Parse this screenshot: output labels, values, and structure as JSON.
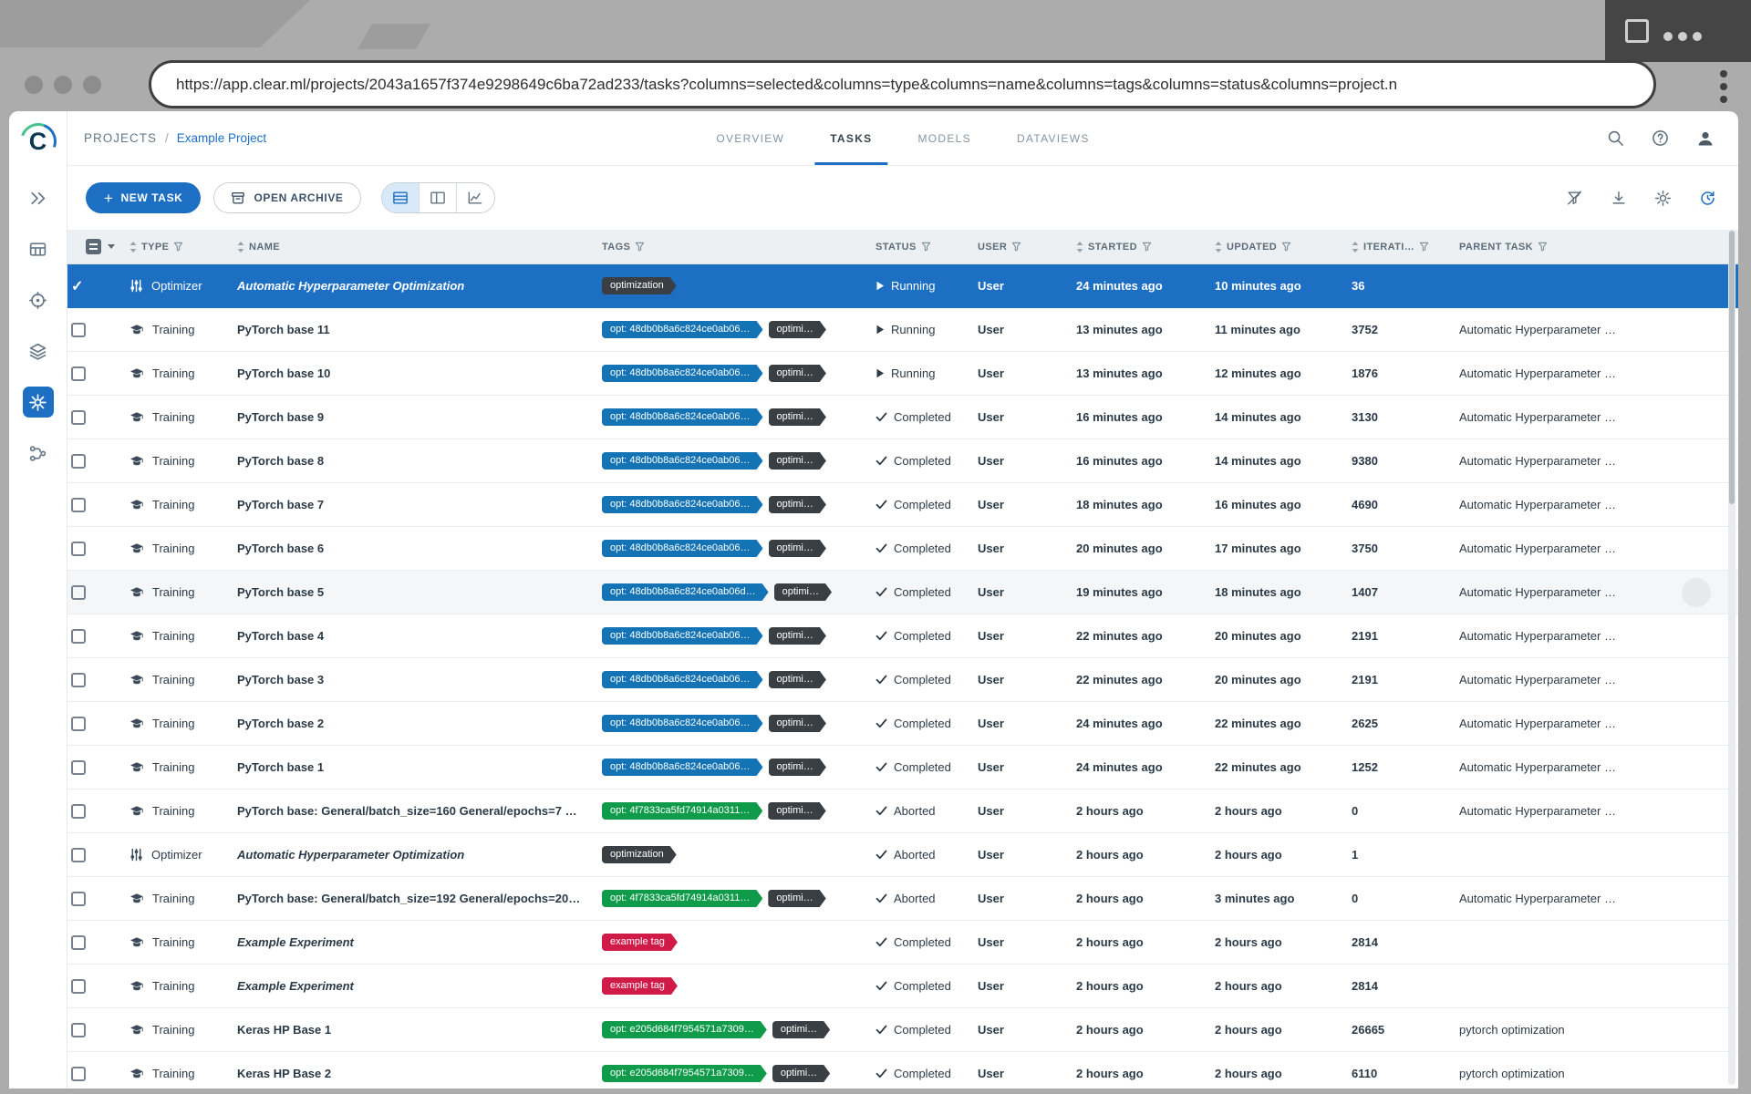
{
  "browser": {
    "url": "https://app.clear.ml/projects/2043a1657f374e9298649c6ba72ad233/tasks?columns=selected&columns=type&columns=name&columns=tags&columns=status&columns=project.n"
  },
  "sidebar": {
    "items": [
      {
        "key": "chevrons",
        "icon": "getting-started-icon",
        "active": false
      },
      {
        "key": "grid",
        "icon": "dashboard-grid-icon",
        "active": false
      },
      {
        "key": "target",
        "icon": "reports-icon",
        "active": false
      },
      {
        "key": "layers",
        "icon": "datasets-icon",
        "active": false
      },
      {
        "key": "node",
        "icon": "projects-icon",
        "active": true
      },
      {
        "key": "pipeline",
        "icon": "pipelines-icon",
        "active": false
      }
    ]
  },
  "header": {
    "breadcrumb": {
      "root": "PROJECTS",
      "separator": "/",
      "current": "Example Project"
    },
    "tabs": [
      {
        "label": "OVERVIEW",
        "active": false
      },
      {
        "label": "TASKS",
        "active": true
      },
      {
        "label": "MODELS",
        "active": false
      },
      {
        "label": "DATAVIEWS",
        "active": false
      }
    ]
  },
  "toolbar": {
    "new_task_plus": "+",
    "new_task": "NEW TASK",
    "open_archive": "OPEN ARCHIVE"
  },
  "table": {
    "columns": [
      {
        "key": "type",
        "label": "TYPE",
        "sort": true,
        "filter": true
      },
      {
        "key": "name",
        "label": "NAME",
        "sort": true,
        "filter": false
      },
      {
        "key": "tags",
        "label": "TAGS",
        "sort": false,
        "filter": true
      },
      {
        "key": "status",
        "label": "STATUS",
        "sort": false,
        "filter": true
      },
      {
        "key": "user",
        "label": "USER",
        "sort": false,
        "filter": true
      },
      {
        "key": "started",
        "label": "STARTED",
        "sort": true,
        "filter": true
      },
      {
        "key": "updated",
        "label": "UPDATED",
        "sort": true,
        "filter": true
      },
      {
        "key": "iterations",
        "label": "ITERATI…",
        "sort": true,
        "filter": true
      },
      {
        "key": "parent",
        "label": "PARENT TASK",
        "sort": false,
        "filter": true
      }
    ],
    "rows": [
      {
        "selected": true,
        "type": "Optimizer",
        "name": "Automatic Hyperparameter Optimization",
        "italic": true,
        "tags": [
          {
            "text": "optimization",
            "color": "dark"
          }
        ],
        "status": "Running",
        "status_kind": "running",
        "user": "User",
        "started": "24 minutes ago",
        "updated": "10 minutes ago",
        "iterations": "36",
        "parent": ""
      },
      {
        "type": "Training",
        "name": "PyTorch base 11",
        "tags": [
          {
            "text": "opt: 48db0b8a6c824ce0ab06…",
            "color": "blue"
          },
          {
            "text": "optimi…",
            "color": "dark"
          }
        ],
        "status": "Running",
        "status_kind": "running",
        "user": "User",
        "started": "13 minutes ago",
        "updated": "11 minutes ago",
        "iterations": "3752",
        "parent": "Automatic Hyperparameter …"
      },
      {
        "type": "Training",
        "name": "PyTorch base 10",
        "tags": [
          {
            "text": "opt: 48db0b8a6c824ce0ab06…",
            "color": "blue"
          },
          {
            "text": "optimi…",
            "color": "dark"
          }
        ],
        "status": "Running",
        "status_kind": "running",
        "user": "User",
        "started": "13 minutes ago",
        "updated": "12 minutes ago",
        "iterations": "1876",
        "parent": "Automatic Hyperparameter …"
      },
      {
        "type": "Training",
        "name": "PyTorch base 9",
        "tags": [
          {
            "text": "opt: 48db0b8a6c824ce0ab06…",
            "color": "blue"
          },
          {
            "text": "optimi…",
            "color": "dark"
          }
        ],
        "status": "Completed",
        "status_kind": "completed",
        "user": "User",
        "started": "16 minutes ago",
        "updated": "14 minutes ago",
        "iterations": "3130",
        "parent": "Automatic Hyperparameter …"
      },
      {
        "type": "Training",
        "name": "PyTorch base 8",
        "tags": [
          {
            "text": "opt: 48db0b8a6c824ce0ab06…",
            "color": "blue"
          },
          {
            "text": "optimi…",
            "color": "dark"
          }
        ],
        "status": "Completed",
        "status_kind": "completed",
        "user": "User",
        "started": "16 minutes ago",
        "updated": "14 minutes ago",
        "iterations": "9380",
        "parent": "Automatic Hyperparameter …"
      },
      {
        "type": "Training",
        "name": "PyTorch base 7",
        "tags": [
          {
            "text": "opt: 48db0b8a6c824ce0ab06…",
            "color": "blue"
          },
          {
            "text": "optimi…",
            "color": "dark"
          }
        ],
        "status": "Completed",
        "status_kind": "completed",
        "user": "User",
        "started": "18 minutes ago",
        "updated": "16 minutes ago",
        "iterations": "4690",
        "parent": "Automatic Hyperparameter …"
      },
      {
        "type": "Training",
        "name": "PyTorch base 6",
        "tags": [
          {
            "text": "opt: 48db0b8a6c824ce0ab06…",
            "color": "blue"
          },
          {
            "text": "optimi…",
            "color": "dark"
          }
        ],
        "status": "Completed",
        "status_kind": "completed",
        "user": "User",
        "started": "20 minutes ago",
        "updated": "17 minutes ago",
        "iterations": "3750",
        "parent": "Automatic Hyperparameter …"
      },
      {
        "hover": true,
        "type": "Training",
        "name": "PyTorch base 5",
        "tags": [
          {
            "text": "opt: 48db0b8a6c824ce0ab06d…",
            "color": "blue"
          },
          {
            "text": "optimi…",
            "color": "dark"
          }
        ],
        "status": "Completed",
        "status_kind": "completed",
        "user": "User",
        "started": "19 minutes ago",
        "updated": "18 minutes ago",
        "iterations": "1407",
        "parent": "Automatic Hyperparameter …"
      },
      {
        "type": "Training",
        "name": "PyTorch base 4",
        "tags": [
          {
            "text": "opt: 48db0b8a6c824ce0ab06…",
            "color": "blue"
          },
          {
            "text": "optimi…",
            "color": "dark"
          }
        ],
        "status": "Completed",
        "status_kind": "completed",
        "user": "User",
        "started": "22 minutes ago",
        "updated": "20 minutes ago",
        "iterations": "2191",
        "parent": "Automatic Hyperparameter …"
      },
      {
        "type": "Training",
        "name": "PyTorch base 3",
        "tags": [
          {
            "text": "opt: 48db0b8a6c824ce0ab06…",
            "color": "blue"
          },
          {
            "text": "optimi…",
            "color": "dark"
          }
        ],
        "status": "Completed",
        "status_kind": "completed",
        "user": "User",
        "started": "22 minutes ago",
        "updated": "20 minutes ago",
        "iterations": "2191",
        "parent": "Automatic Hyperparameter …"
      },
      {
        "type": "Training",
        "name": "PyTorch base 2",
        "tags": [
          {
            "text": "opt: 48db0b8a6c824ce0ab06…",
            "color": "blue"
          },
          {
            "text": "optimi…",
            "color": "dark"
          }
        ],
        "status": "Completed",
        "status_kind": "completed",
        "user": "User",
        "started": "24 minutes ago",
        "updated": "22 minutes ago",
        "iterations": "2625",
        "parent": "Automatic Hyperparameter …"
      },
      {
        "type": "Training",
        "name": "PyTorch base 1",
        "tags": [
          {
            "text": "opt: 48db0b8a6c824ce0ab06…",
            "color": "blue"
          },
          {
            "text": "optimi…",
            "color": "dark"
          }
        ],
        "status": "Completed",
        "status_kind": "completed",
        "user": "User",
        "started": "24 minutes ago",
        "updated": "22 minutes ago",
        "iterations": "1252",
        "parent": "Automatic Hyperparameter …"
      },
      {
        "type": "Training",
        "name": "PyTorch base: General/batch_size=160 General/epochs=7 …",
        "tags": [
          {
            "text": "opt: 4f7833ca5fd74914a0311…",
            "color": "green"
          },
          {
            "text": "optimi…",
            "color": "dark"
          }
        ],
        "status": "Aborted",
        "status_kind": "aborted",
        "user": "User",
        "started": "2 hours ago",
        "updated": "2 hours ago",
        "iterations": "0",
        "parent": "Automatic Hyperparameter …"
      },
      {
        "type": "Optimizer",
        "name": "Automatic Hyperparameter Optimization",
        "italic": true,
        "tags": [
          {
            "text": "optimization",
            "color": "dark"
          }
        ],
        "status": "Aborted",
        "status_kind": "aborted",
        "user": "User",
        "started": "2 hours ago",
        "updated": "2 hours ago",
        "iterations": "1",
        "parent": ""
      },
      {
        "type": "Training",
        "name": "PyTorch base: General/batch_size=192 General/epochs=20…",
        "tags": [
          {
            "text": "opt: 4f7833ca5fd74914a0311…",
            "color": "green"
          },
          {
            "text": "optimi…",
            "color": "dark"
          }
        ],
        "status": "Aborted",
        "status_kind": "aborted",
        "user": "User",
        "started": "2 hours ago",
        "updated": "3 minutes ago",
        "iterations": "0",
        "parent": "Automatic Hyperparameter …"
      },
      {
        "type": "Training",
        "name": "Example Experiment",
        "italic": true,
        "tags": [
          {
            "text": "example tag",
            "color": "red"
          }
        ],
        "status": "Completed",
        "status_kind": "completed",
        "user": "User",
        "started": "2 hours ago",
        "updated": "2 hours ago",
        "iterations": "2814",
        "parent": ""
      },
      {
        "type": "Training",
        "name": "Example Experiment",
        "italic": true,
        "tags": [
          {
            "text": "example tag",
            "color": "red"
          }
        ],
        "status": "Completed",
        "status_kind": "completed",
        "user": "User",
        "started": "2 hours ago",
        "updated": "2 hours ago",
        "iterations": "2814",
        "parent": ""
      },
      {
        "type": "Training",
        "name": "Keras HP Base 1",
        "tags": [
          {
            "text": "opt: e205d684f7954571a7309…",
            "color": "green"
          },
          {
            "text": "optimi…",
            "color": "dark"
          }
        ],
        "status": "Completed",
        "status_kind": "completed",
        "user": "User",
        "started": "2 hours ago",
        "updated": "2 hours ago",
        "iterations": "26665",
        "parent": "pytorch optimization"
      },
      {
        "type": "Training",
        "name": "Keras HP Base 2",
        "tags": [
          {
            "text": "opt: e205d684f7954571a7309…",
            "color": "green"
          },
          {
            "text": "optimi…",
            "color": "dark"
          }
        ],
        "status": "Completed",
        "status_kind": "completed",
        "user": "User",
        "started": "2 hours ago",
        "updated": "2 hours ago",
        "iterations": "6110",
        "parent": "pytorch optimization"
      }
    ]
  },
  "colors": {
    "accent_blue": "#1d6fc4",
    "selected_row_bg": "#1d6fc4",
    "status": {
      "running": "#27a658",
      "completed": "#4a90d9",
      "aborted": "#dfa32b"
    },
    "tags": {
      "blue": "#1373b5",
      "green": "#0f9b4a",
      "dark": "#3a3f44",
      "red": "#d01a47"
    }
  }
}
